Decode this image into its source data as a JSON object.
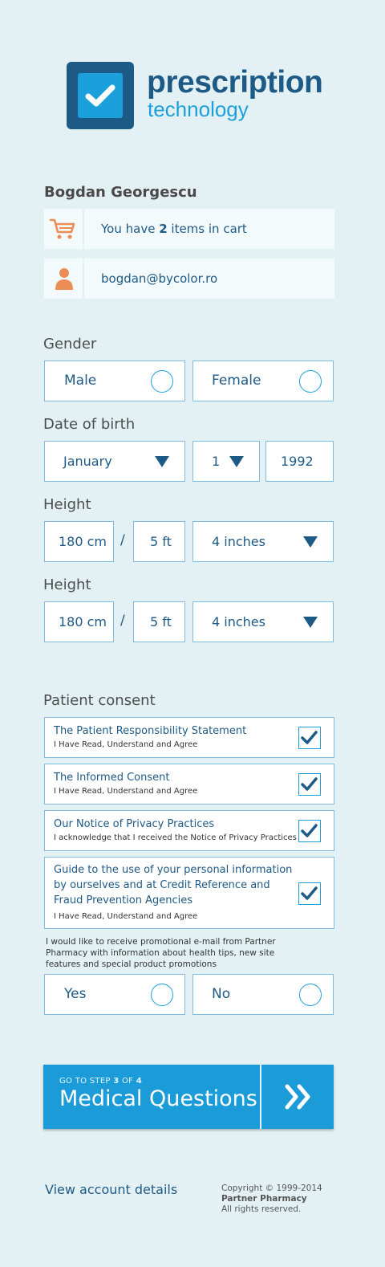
{
  "brand": {
    "title": "prescription",
    "subtitle": "technology",
    "logo_icon": "checkmark-icon",
    "primary_color": "#1d5a85",
    "accent_color": "#1ba0dc"
  },
  "user": {
    "name": "Bogdan Georgescu",
    "cart_prefix": "You have ",
    "cart_count": "2",
    "cart_suffix": " items in cart",
    "email": "bogdan@bycolor.ro",
    "cart_icon": "cart-icon",
    "user_icon": "user-icon",
    "icon_color": "#ee8c55"
  },
  "gender": {
    "label": "Gender",
    "options": [
      "Male",
      "Female"
    ]
  },
  "dob": {
    "label": "Date of birth",
    "month": "January",
    "day": "1",
    "year": "1992"
  },
  "height1": {
    "label": "Height",
    "cm": "180 cm",
    "separator": "/",
    "ft": "5 ft",
    "inches": "4 inches"
  },
  "height2": {
    "label": "Height",
    "cm": "180 cm",
    "separator": "/",
    "ft": "5 ft",
    "inches": "4 inches"
  },
  "consent": {
    "label": "Patient consent",
    "items": [
      {
        "title": "The Patient Responsibility Statement",
        "sub": "I Have Read, Understand and Agree",
        "checked": true
      },
      {
        "title": "The Informed Consent",
        "sub": "I Have Read, Understand and Agree",
        "checked": true
      },
      {
        "title": "Our Notice of Privacy Practices",
        "sub": "I acknowledge that I received the Notice of Privacy Practices",
        "checked": true
      },
      {
        "title": "Guide to the use of your personal information by ourselves and at Credit Reference and Fraud Prevention Agencies",
        "title_lines": [
          "Guide to the use of your personal information",
          "by ourselves and at Credit Reference and",
          "Fraud Prevention Agencies"
        ],
        "sub": "I Have Read, Understand and Agree",
        "checked": true
      }
    ]
  },
  "promo": {
    "text": "I would like to receive promotional e-mail from Partner Pharmacy with information about health tips, new site features and special product promotions",
    "options": [
      "Yes",
      "No"
    ]
  },
  "cta": {
    "step_prefix": "GO TO STEP ",
    "step_current": "3",
    "step_mid": " OF ",
    "step_total": "4",
    "title": "Medical Questions",
    "arrow_icon": "double-chevron-right-icon"
  },
  "footer": {
    "link": "View account details",
    "copyright": "Copyright © 1999-2014",
    "company": "Partner Pharmacy",
    "rights": "All rights reserved."
  }
}
